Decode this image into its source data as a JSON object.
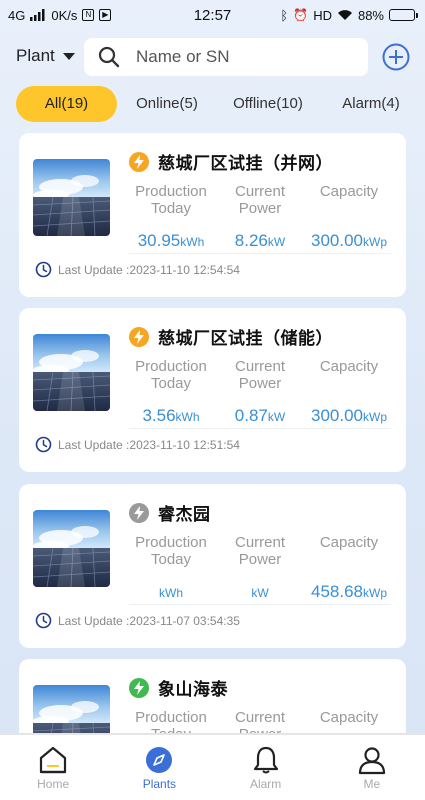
{
  "status_bar": {
    "network": "4G",
    "speed": "0K/s",
    "time": "12:57",
    "bluetooth_icon": "bluetooth-icon",
    "hd": "HD",
    "battery": "88%",
    "battery_level": 0.88
  },
  "header": {
    "plant_selector": "Plant",
    "search_placeholder": "Name or SN",
    "add_icon": "add-circle-icon"
  },
  "tabs": {
    "all": "All(19)",
    "online": "Online(5)",
    "offline": "Offline(10)",
    "alarm": "Alarm(4)"
  },
  "labels": {
    "production_today": "Production Today",
    "current_power": "Current Power",
    "capacity": "Capacity",
    "last_update": "Last Update :"
  },
  "plants": [
    {
      "name": "慈城厂区试挂（并网）",
      "status_color": "#f5a623",
      "production": "30.95",
      "production_unit": "kWh",
      "power": "8.26",
      "power_unit": "kW",
      "capacity": "300.00",
      "capacity_unit": "kWp",
      "last_update": "2023-11-10 12:54:54"
    },
    {
      "name": "慈城厂区试挂（储能）",
      "status_color": "#f5a623",
      "production": "3.56",
      "production_unit": "kWh",
      "power": "0.87",
      "power_unit": "kW",
      "capacity": "300.00",
      "capacity_unit": "kWp",
      "last_update": "2023-11-10 12:51:54"
    },
    {
      "name": "睿杰园",
      "status_color": "#9a9a9a",
      "production": "",
      "production_unit": "kWh",
      "power": "",
      "power_unit": "kW",
      "capacity": "458.68",
      "capacity_unit": "kWp",
      "last_update": "2023-11-07 03:54:35"
    },
    {
      "name": "象山海泰",
      "status_color": "#3fb950",
      "production": "",
      "production_unit": "",
      "power": "",
      "power_unit": "",
      "capacity": "",
      "capacity_unit": "",
      "last_update": ""
    }
  ],
  "bottom_nav": {
    "home": "Home",
    "plants": "Plants",
    "alarm": "Alarm",
    "me": "Me",
    "active_color": "#3b6fd8"
  }
}
